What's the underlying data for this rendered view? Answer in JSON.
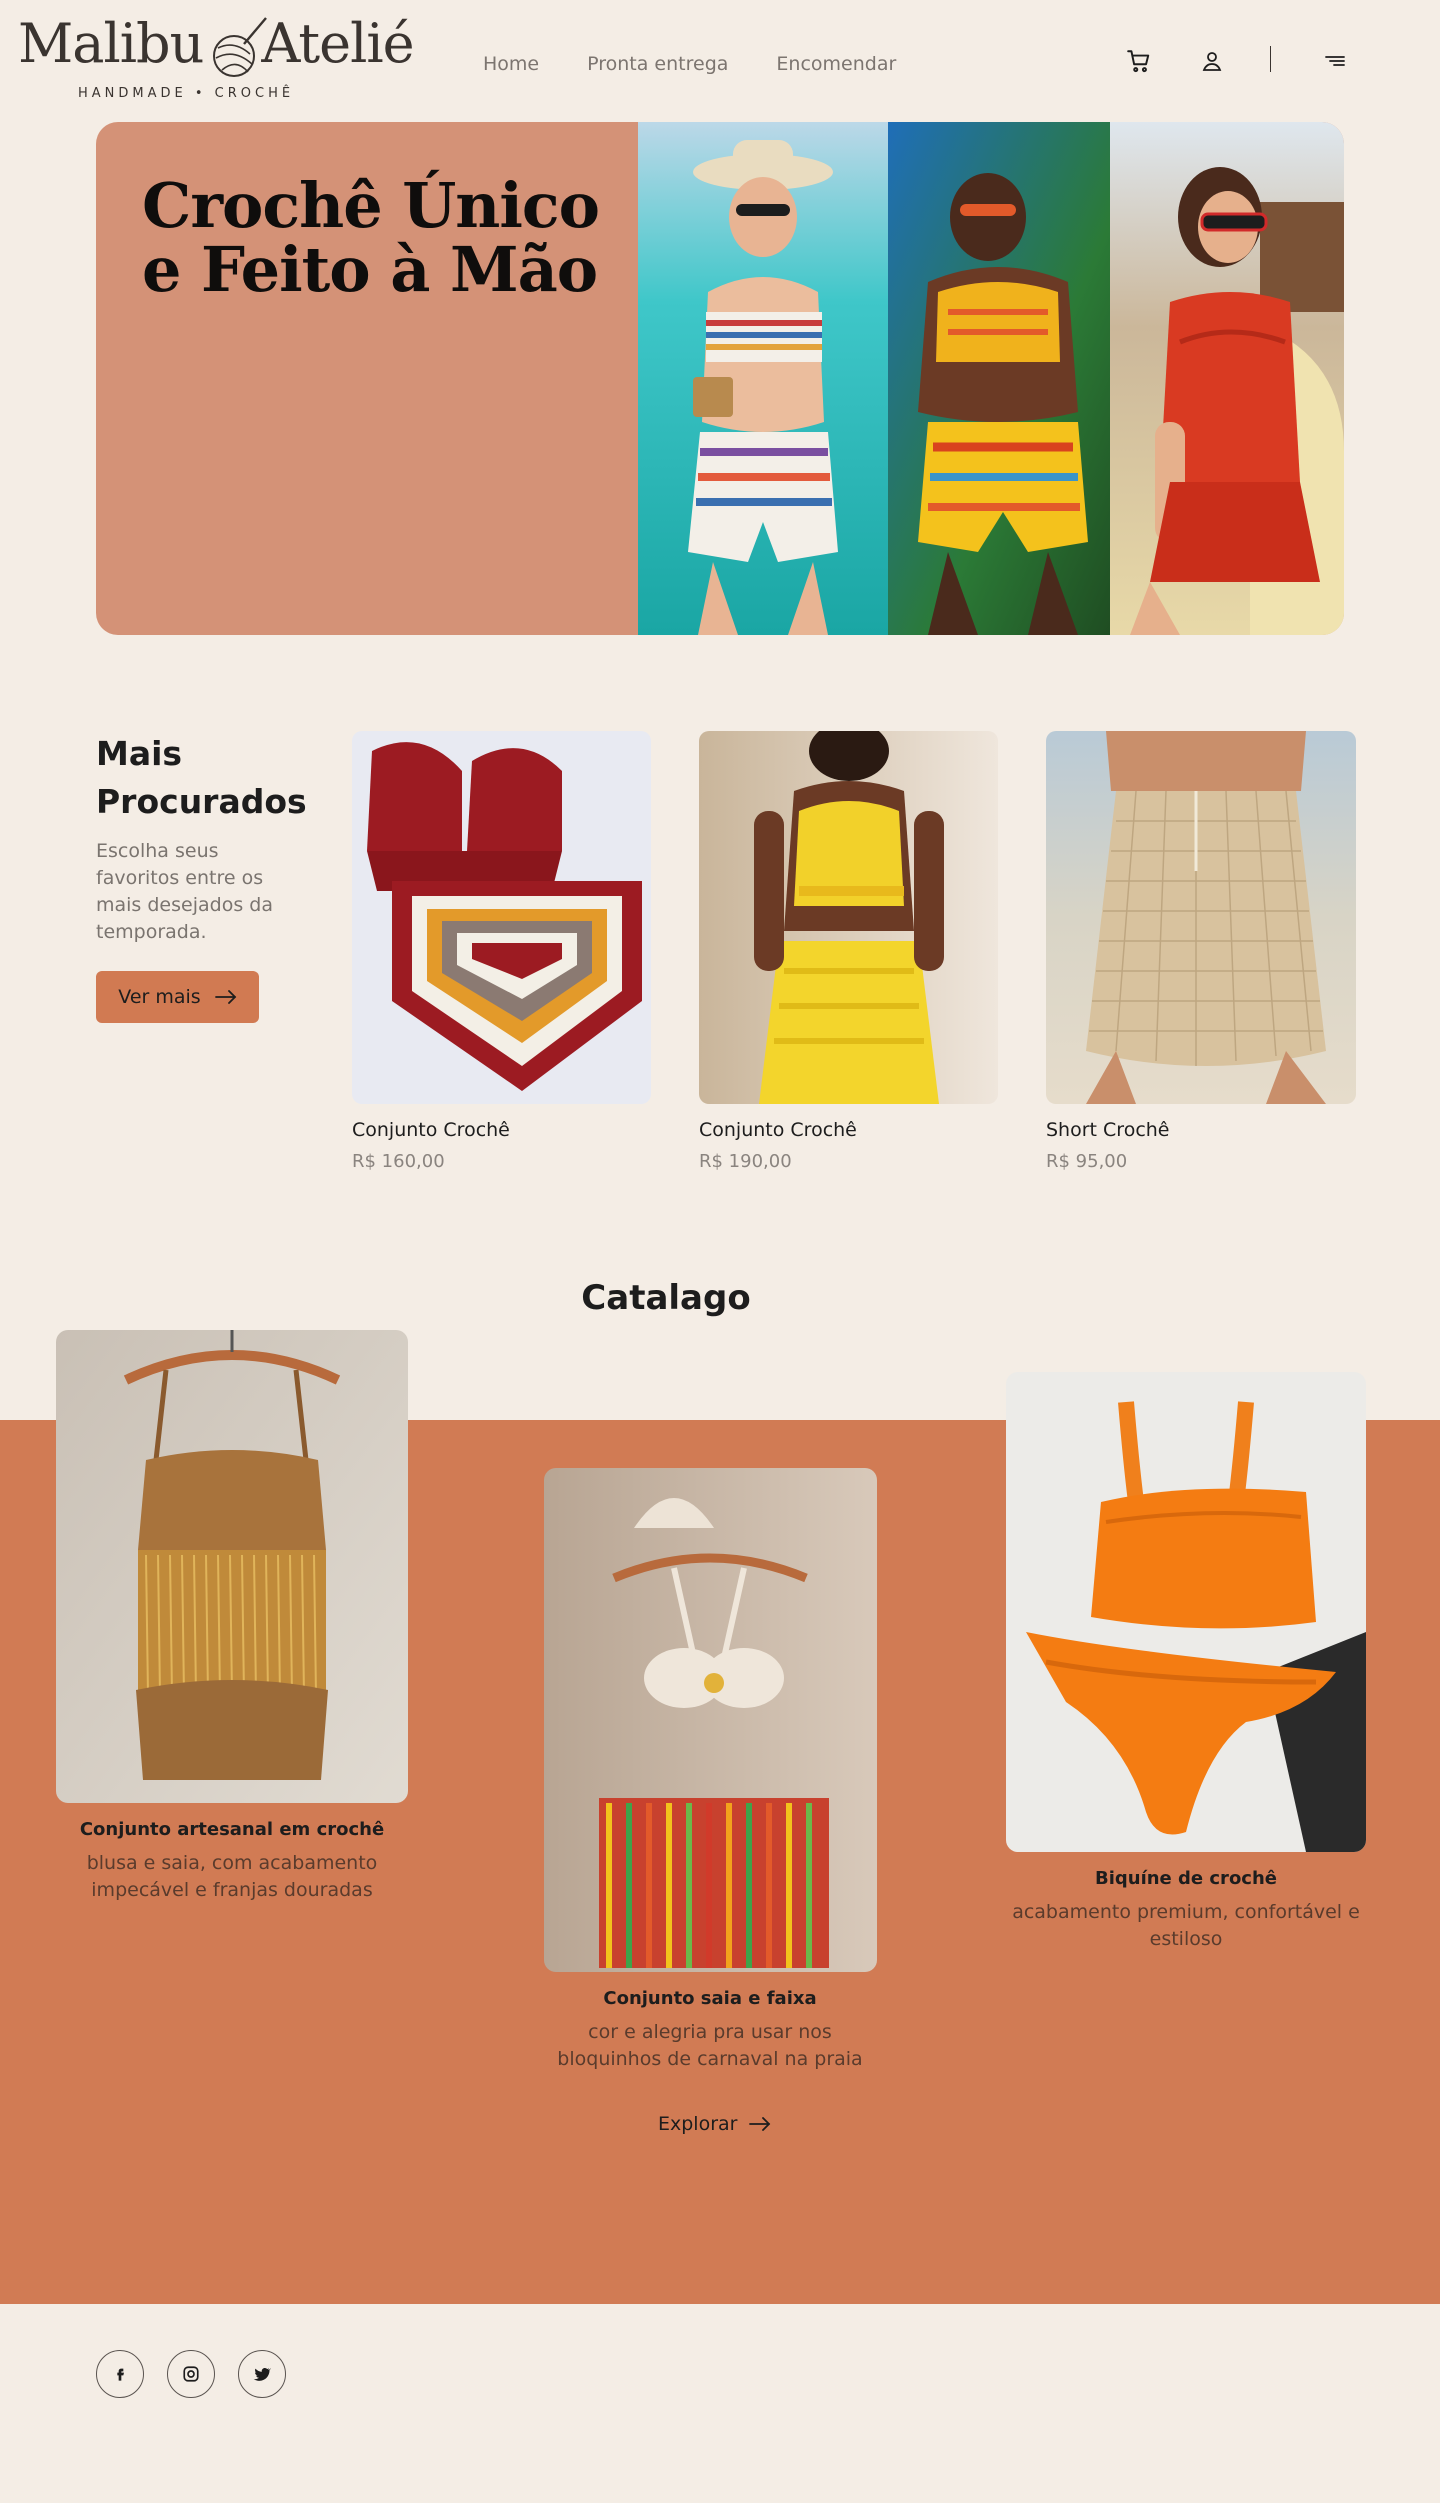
{
  "brand": {
    "name_left": "Malibu",
    "name_right": "Atelié",
    "tagline": "HANDMADE • CROCHÊ"
  },
  "nav": {
    "home": "Home",
    "ready": "Pronta entrega",
    "order": "Encomendar"
  },
  "header_icons": [
    "cart-icon",
    "user-icon",
    "menu-icon"
  ],
  "hero": {
    "title": "Crochê Único e Feito à Mão"
  },
  "popular": {
    "title": "Mais Procurados",
    "subtitle": "Escolha seus favoritos entre os mais desejados da temporada.",
    "button_label": "Ver mais",
    "products": [
      {
        "name": "Conjunto Crochê",
        "price": "R$ 160,00"
      },
      {
        "name": "Conjunto Crochê",
        "price": "R$ 190,00"
      },
      {
        "name": "Short Crochê",
        "price": "R$ 95,00"
      }
    ]
  },
  "catalog": {
    "title": "Catalago",
    "items": [
      {
        "name": "Conjunto artesanal em crochê",
        "desc": "blusa e saia, com acabamento impecável e franjas douradas"
      },
      {
        "name": "Conjunto saia e faixa",
        "desc": "cor e alegria pra usar nos bloquinhos de carnaval na praia"
      },
      {
        "name": "Biquíne de crochê",
        "desc": "acabamento premium, confortável e estiloso"
      }
    ],
    "explore_label": "Explorar"
  },
  "footer": {
    "social_icons": [
      "facebook-icon",
      "instagram-icon",
      "twitter-icon"
    ]
  },
  "colors": {
    "background": "#f4ede5",
    "accent": "#d17b54",
    "hero_panel": "#d49277",
    "text": "#1d1d1d",
    "muted": "#7a746f"
  }
}
